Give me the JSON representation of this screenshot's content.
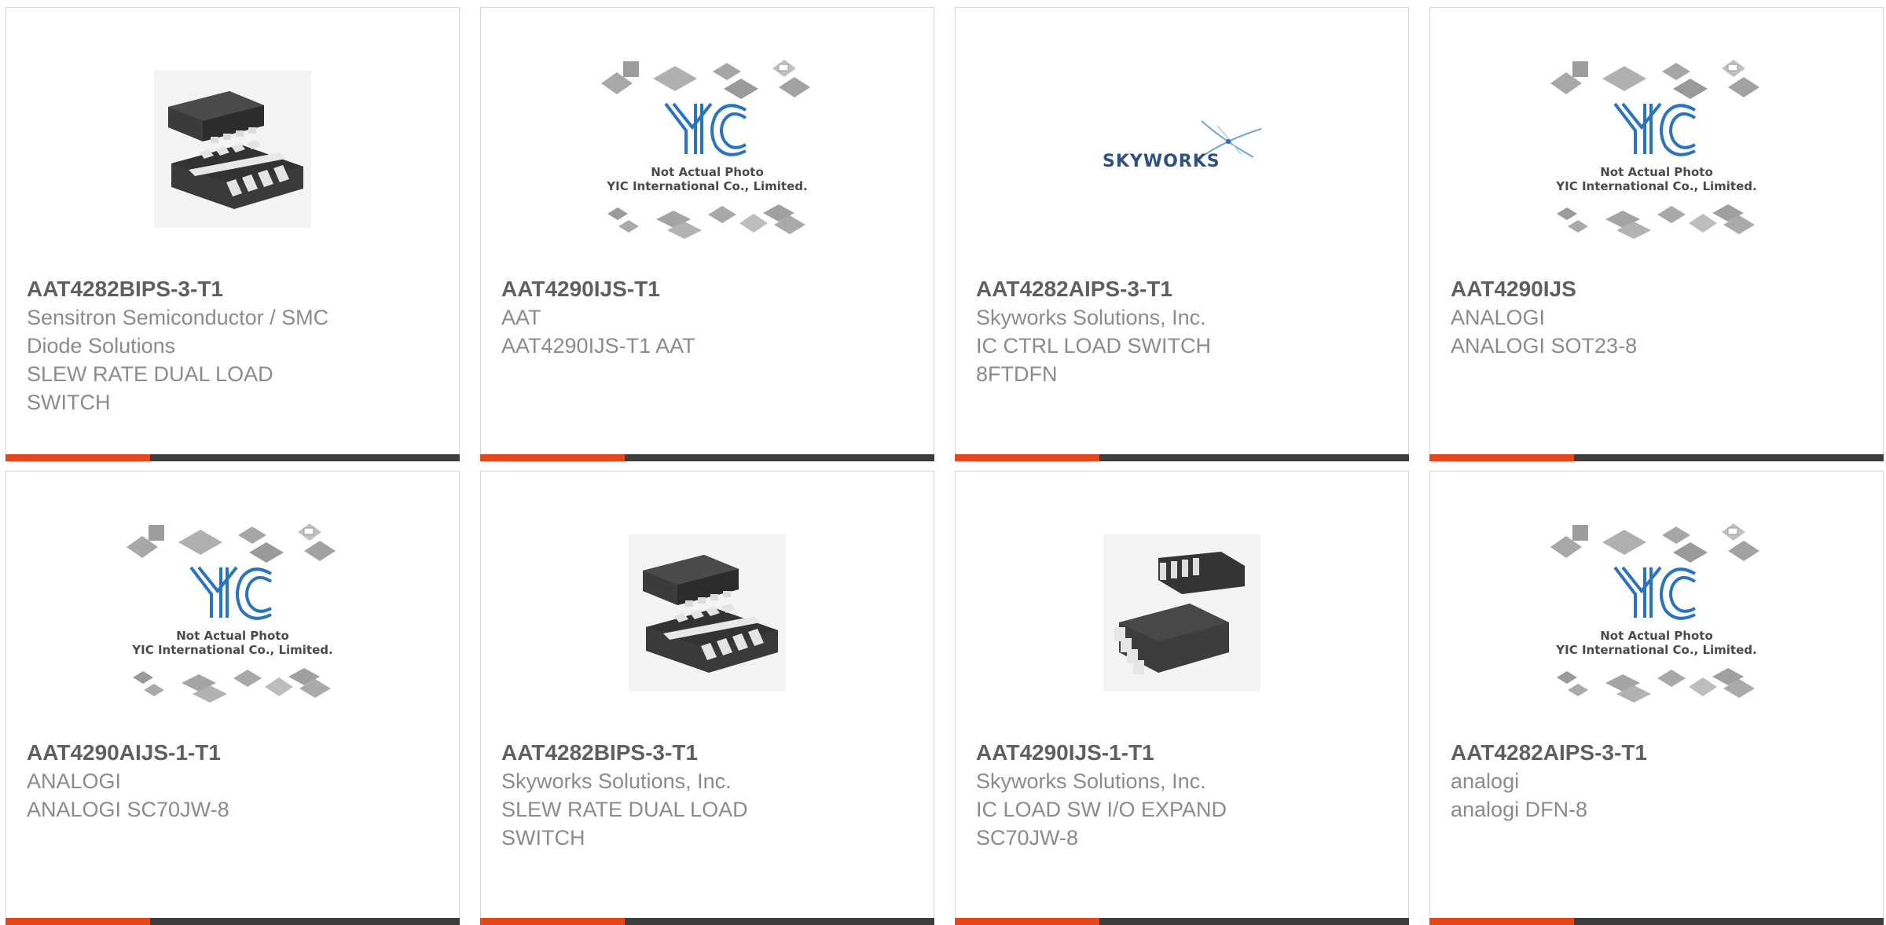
{
  "colors": {
    "accent": "#e5461b",
    "bar": "#3d3d3d",
    "border": "#d4d4d4"
  },
  "placeholder": {
    "caption1": "Not Actual Photo",
    "caption2": "YIC International Co., Limited.",
    "logo_text": "YIC"
  },
  "cards": [
    {
      "part_number": "AAT4282BIPS-3-T1",
      "lines": [
        "Sensitron Semiconductor / SMC",
        "Diode Solutions",
        "SLEW RATE DUAL LOAD",
        "SWITCH"
      ],
      "image": "dfn-chip"
    },
    {
      "part_number": "AAT4290IJS-T1",
      "lines": [
        "AAT",
        "AAT4290IJS-T1 AAT"
      ],
      "image": "yic-placeholder"
    },
    {
      "part_number": "AAT4282AIPS-3-T1",
      "lines": [
        "Skyworks Solutions, Inc.",
        "IC CTRL LOAD SWITCH",
        "8FTDFN"
      ],
      "image": "skyworks-logo",
      "logo_text": "SKYWORKS"
    },
    {
      "part_number": "AAT4290IJS",
      "lines": [
        "ANALOGI",
        "ANALOGI SOT23-8"
      ],
      "image": "yic-placeholder"
    },
    {
      "part_number": "AAT4290AIJS-1-T1",
      "lines": [
        "ANALOGI",
        "ANALOGI SC70JW-8"
      ],
      "image": "yic-placeholder"
    },
    {
      "part_number": "AAT4282BIPS-3-T1",
      "lines": [
        "Skyworks Solutions, Inc.",
        "SLEW RATE DUAL LOAD",
        "SWITCH"
      ],
      "image": "dfn-chip"
    },
    {
      "part_number": "AAT4290IJS-1-T1",
      "lines": [
        "Skyworks Solutions, Inc.",
        "IC LOAD SW I/O EXPAND",
        "SC70JW-8"
      ],
      "image": "sc70-chip"
    },
    {
      "part_number": "AAT4282AIPS-3-T1",
      "lines": [
        "analogi",
        "analogi DFN-8"
      ],
      "image": "yic-placeholder"
    }
  ]
}
